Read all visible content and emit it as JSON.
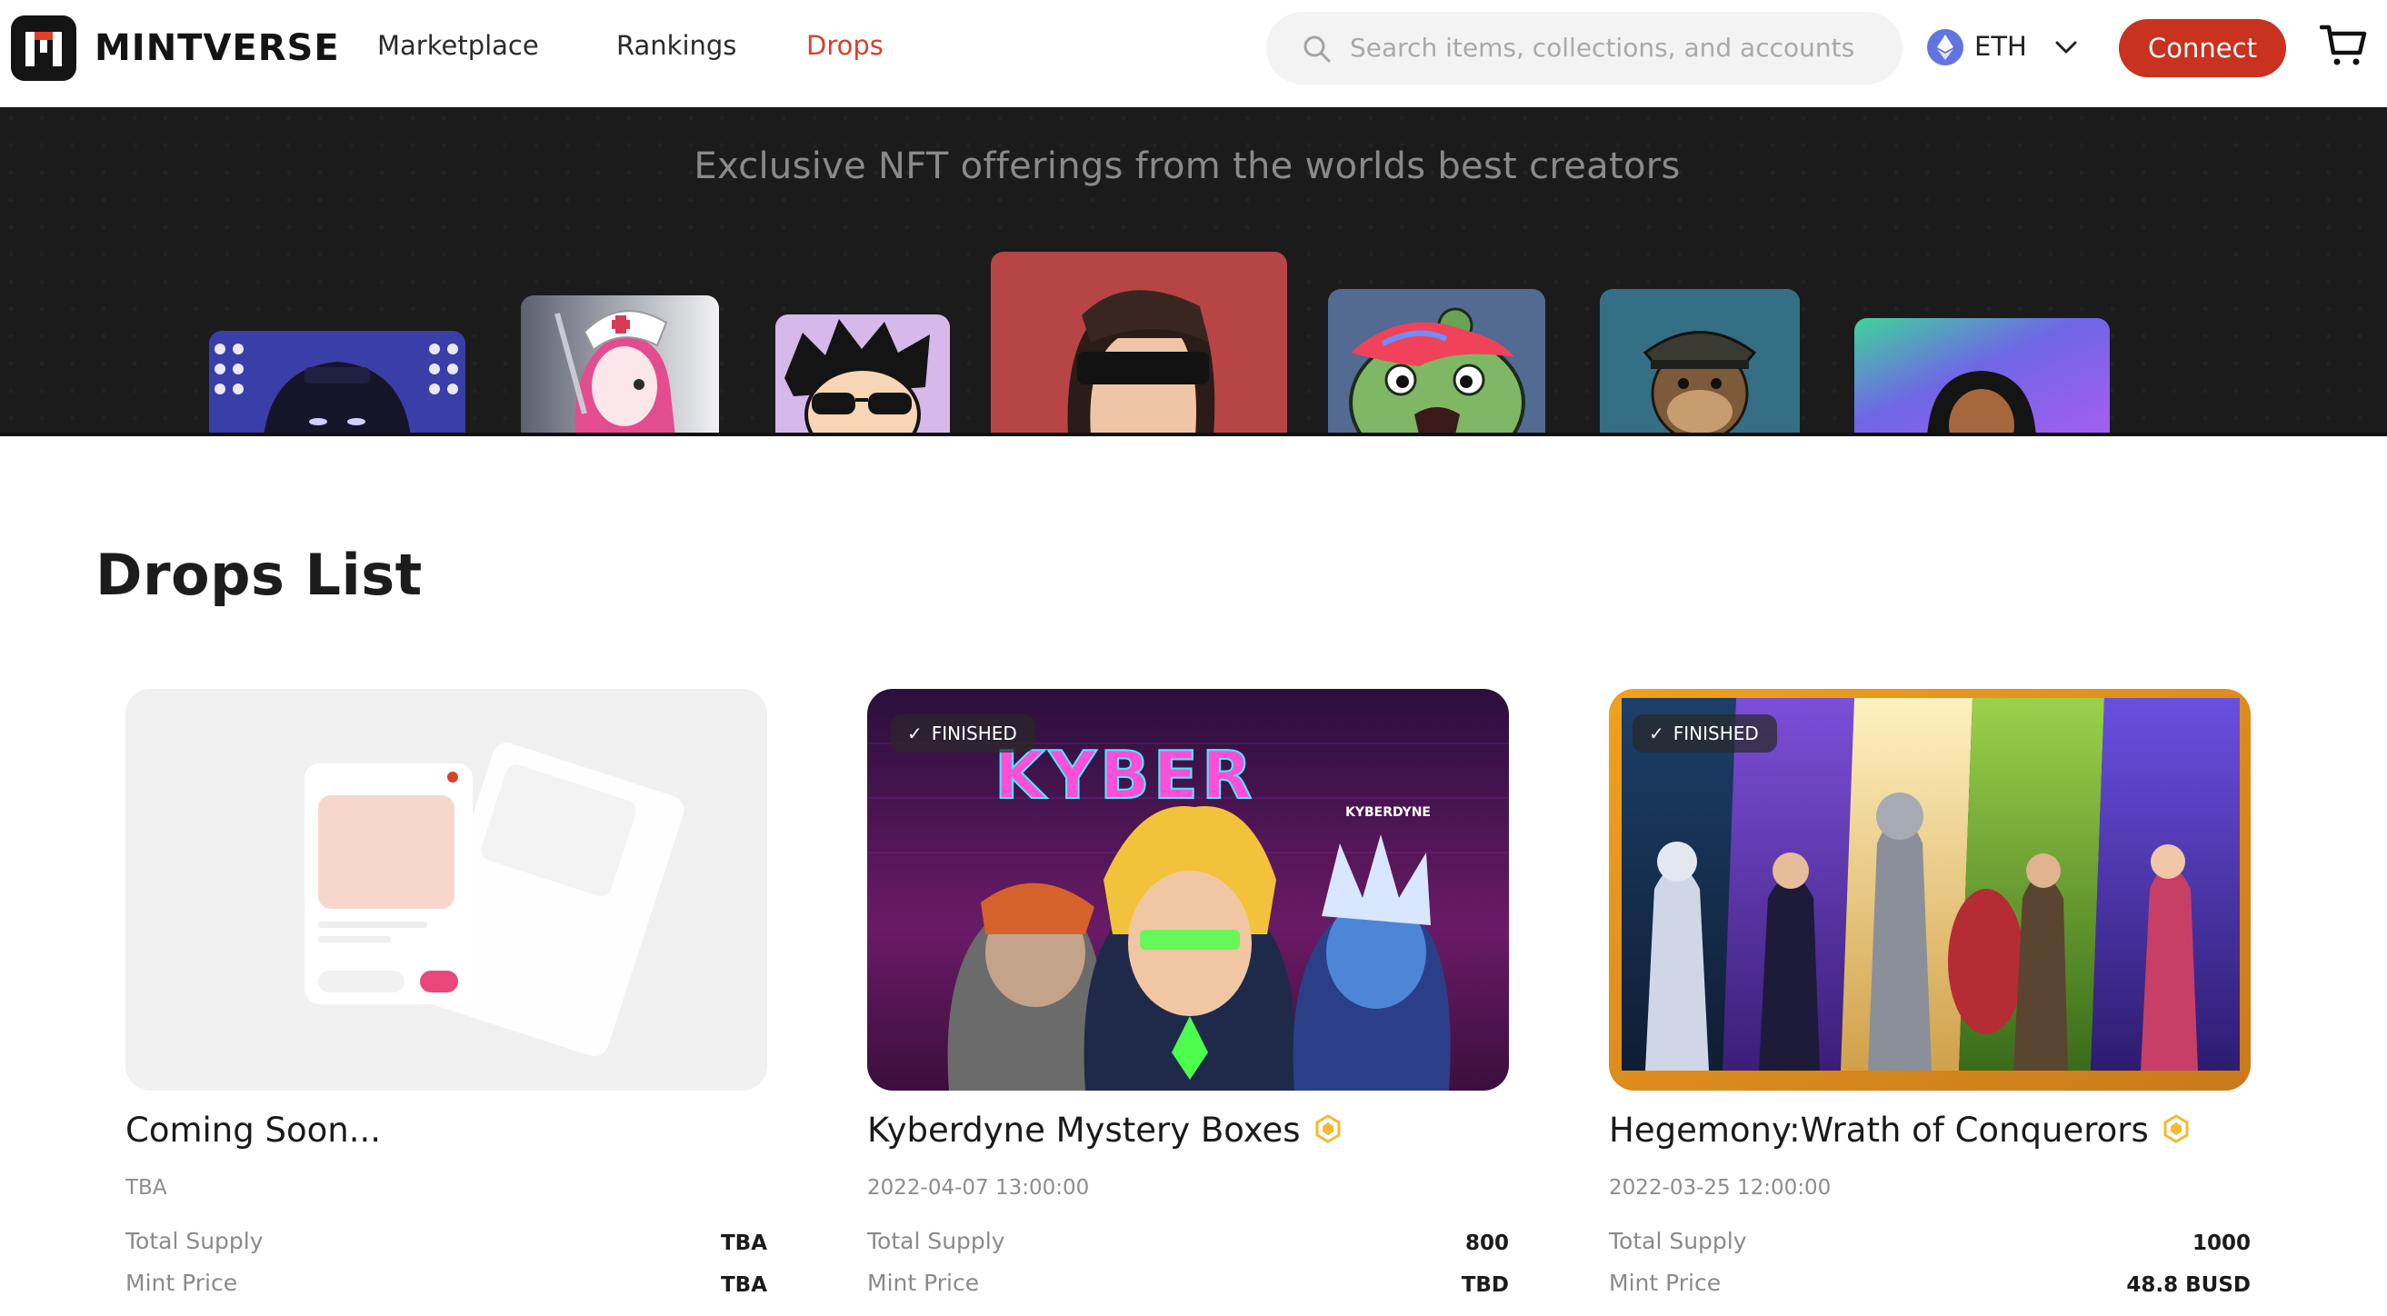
{
  "header": {
    "logo_text": "MINTVERSE",
    "nav": [
      "Marketplace",
      "Rankings",
      "Drops"
    ],
    "active_nav": "Drops",
    "search_placeholder": "Search items, collections, and accounts",
    "chain": "ETH",
    "connect_label": "Connect",
    "accent_color": "#c8321f"
  },
  "hero": {
    "title": "Exclusive NFT offerings from the worlds best creators",
    "thumbnails": [
      "hooded-figure",
      "nurse-anime-girl",
      "sunglasses-boy",
      "masked-man",
      "green-monster",
      "captain-ape",
      "woman-gradient"
    ]
  },
  "drops": {
    "title": "Drops List",
    "total_supply_label": "Total Supply",
    "mint_price_label": "Mint Price",
    "items": [
      {
        "name": "Coming Soon...",
        "date": "TBA",
        "total_supply": "TBA",
        "mint_price": "TBA",
        "status": "",
        "chain_badge": false
      },
      {
        "name": "Kyberdyne Mystery Boxes",
        "date": "2022-04-07 13:00:00",
        "total_supply": "800",
        "mint_price": "TBD",
        "status": "FINISHED",
        "chain_badge": true,
        "banner_text": "KYBERDYNE"
      },
      {
        "name": "Hegemony:Wrath of Conquerors",
        "date": "2022-03-25 12:00:00",
        "total_supply": "1000",
        "mint_price": "48.8 BUSD",
        "status": "FINISHED",
        "chain_badge": true
      }
    ]
  }
}
